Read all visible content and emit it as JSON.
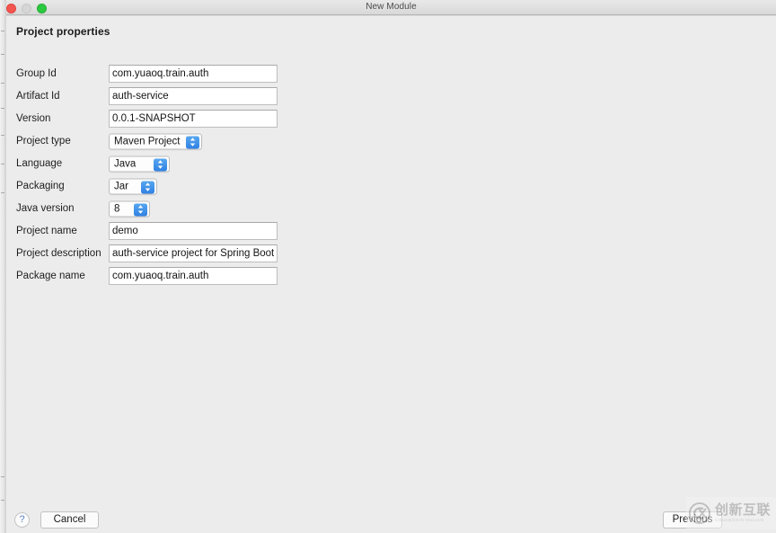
{
  "window": {
    "title": "New Module",
    "traffic_lights": [
      {
        "name": "close-button",
        "color": "#f35650",
        "enabled": true
      },
      {
        "name": "minimize-button",
        "color": "#d6d6d6",
        "enabled": false
      },
      {
        "name": "zoom-button",
        "color": "#2bc940",
        "enabled": true
      }
    ]
  },
  "section": {
    "title": "Project properties"
  },
  "form": {
    "fields": [
      {
        "label": "Group Id",
        "type": "text",
        "value": "com.yuaoq.train.auth",
        "placeholder": ""
      },
      {
        "label": "Artifact Id",
        "type": "text",
        "value": "auth-service",
        "placeholder": ""
      },
      {
        "label": "Version",
        "type": "text",
        "value": "0.0.1-SNAPSHOT",
        "placeholder": ""
      },
      {
        "label": "Project type",
        "type": "popup",
        "value": "Maven Project",
        "width": "w-maven"
      },
      {
        "label": "Language",
        "type": "popup",
        "value": "Java",
        "width": "w-java"
      },
      {
        "label": "Packaging",
        "type": "popup",
        "value": "Jar",
        "width": "w-jar"
      },
      {
        "label": "Java version",
        "type": "popup",
        "value": "8",
        "width": "w-ver"
      },
      {
        "label": "Project name",
        "type": "text",
        "value": "demo",
        "placeholder": ""
      },
      {
        "label": "Project description",
        "type": "text",
        "value": "auth-service project for Spring Boot",
        "placeholder": ""
      },
      {
        "label": "Package name",
        "type": "text",
        "value": "com.yuaoq.train.auth",
        "placeholder": ""
      }
    ]
  },
  "footer": {
    "help_label": "?",
    "cancel_label": "Cancel",
    "previous_label": "Previous"
  },
  "watermark": {
    "chinese": "创新互联",
    "latin": "CHUANGXIN HULIAN",
    "logo": "cx-circle-logo"
  },
  "colors": {
    "accent_blue": "#2f81e4",
    "window_bg": "#ececec",
    "field_bg": "#ffffff",
    "text": "#1e1e1e"
  }
}
